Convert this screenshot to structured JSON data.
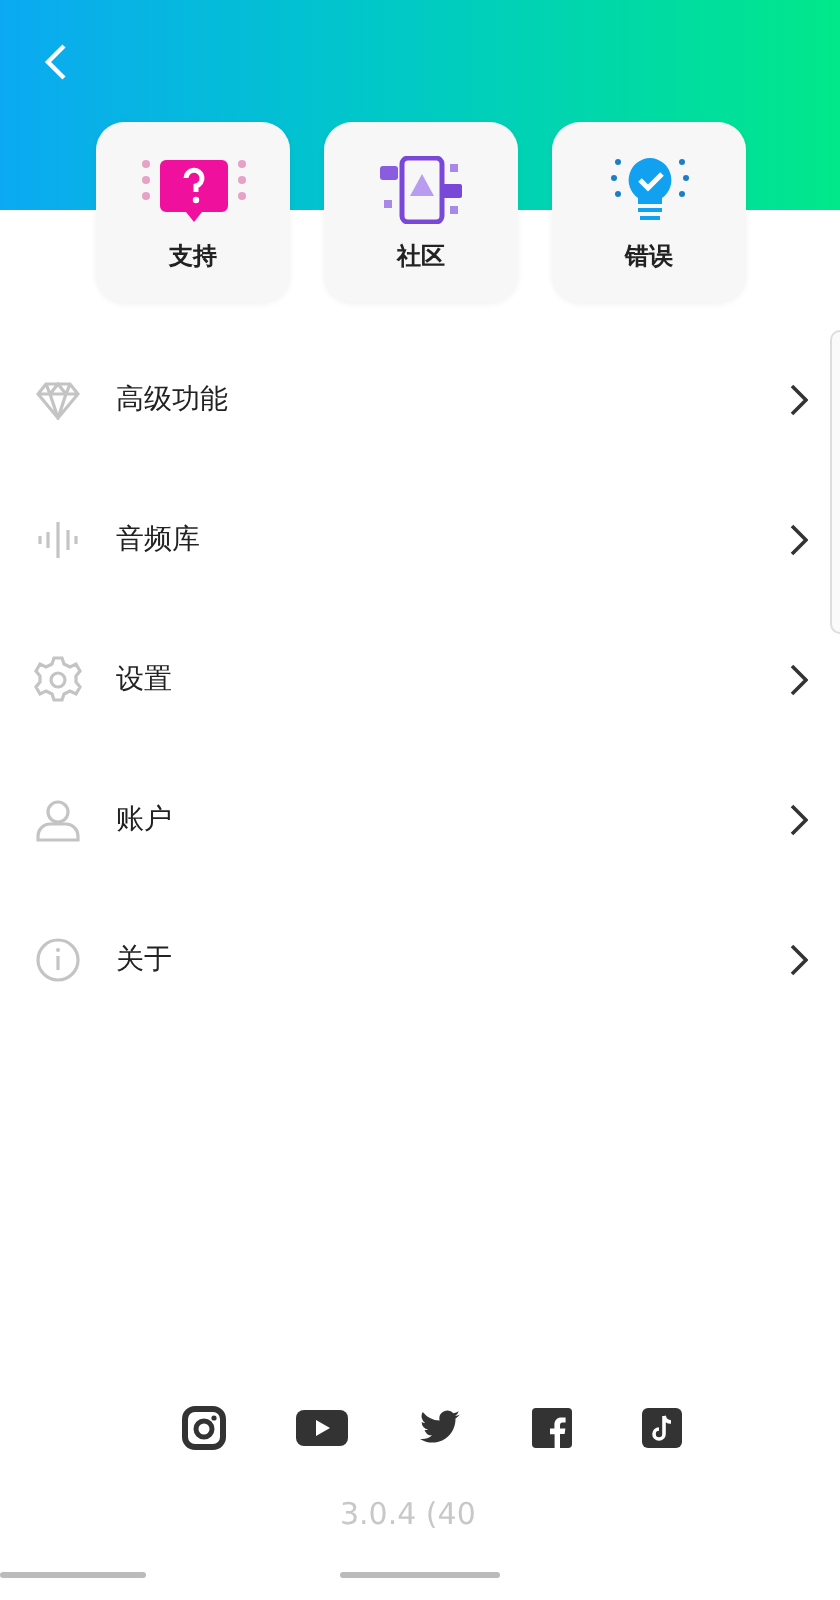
{
  "feature_cards": [
    {
      "label": "支持"
    },
    {
      "label": "社区"
    },
    {
      "label": "错误"
    }
  ],
  "menu_items": [
    {
      "label": "高级功能"
    },
    {
      "label": "音频库"
    },
    {
      "label": "设置"
    },
    {
      "label": "账户"
    },
    {
      "label": "关于"
    }
  ],
  "version": "3.0.4 (40"
}
